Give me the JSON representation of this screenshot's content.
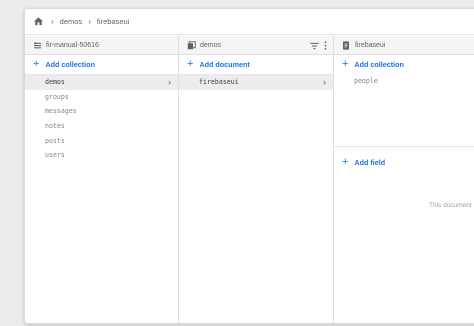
{
  "breadcrumb": {
    "path": [
      "demos",
      "firebaseui"
    ]
  },
  "columns": {
    "project": {
      "title": "fir-manual-50616",
      "add_label": "Add collection",
      "items": [
        "demos",
        "groups",
        "messages",
        "notes",
        "posts",
        "users"
      ],
      "selected_index": 0
    },
    "collection": {
      "title": "demos",
      "add_label": "Add document",
      "items": [
        "firebaseui"
      ],
      "selected_index": 0
    },
    "document": {
      "title": "firebaseui",
      "add_collection_label": "Add collection",
      "subcollections": [
        "people"
      ],
      "add_field_label": "Add field",
      "empty_note": "This document"
    }
  },
  "colors": {
    "accent": "#1a73e8",
    "selected_bg": "#ececec"
  },
  "icons": {
    "home": "home-icon",
    "project": "database-stack-icon",
    "collection": "collection-icon",
    "document": "document-icon",
    "filter": "filter-icon",
    "more": "more-vert-icon",
    "chevron": "chevron-right-icon"
  }
}
